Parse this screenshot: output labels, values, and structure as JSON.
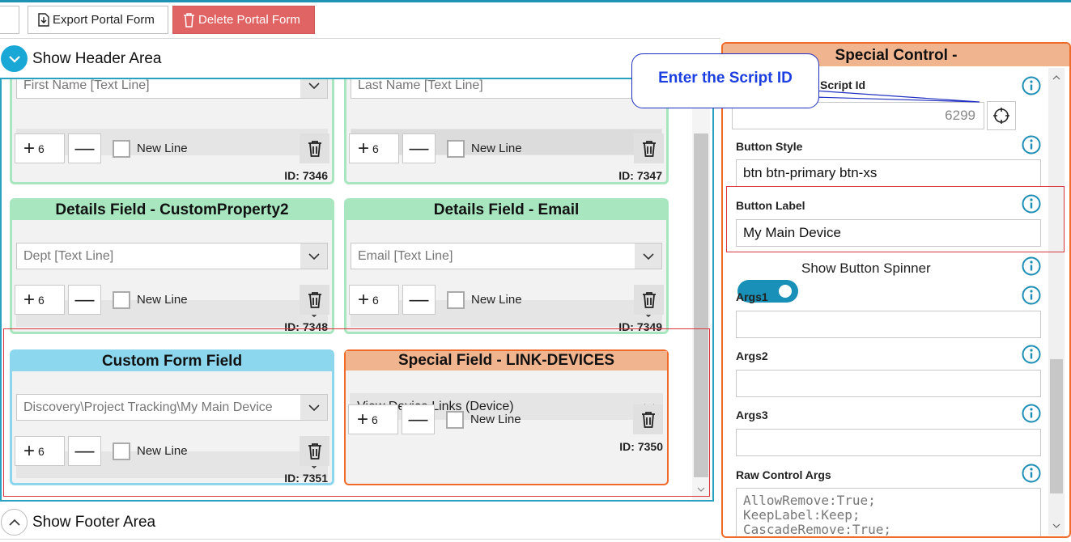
{
  "toolbar": {
    "export_label": "Export Portal Form",
    "delete_label": "Delete Portal Form"
  },
  "header_area": {
    "label": "Show Header Area"
  },
  "footer_area": {
    "label": "Show Footer Area"
  },
  "cards": [
    {
      "title": "",
      "select": "First Name [Text Line]",
      "count": "6",
      "newline": "New Line",
      "id": "ID: 7346"
    },
    {
      "title": "",
      "select": "Last Name [Text Line]",
      "count": "6",
      "newline": "New Line",
      "id": "ID: 7347"
    },
    {
      "title": "Details Field - CustomProperty2",
      "select": "Dept [Text Line]",
      "count": "6",
      "newline": "New Line",
      "id": "ID: 7348"
    },
    {
      "title": "Details Field - Email",
      "select": "Email [Text Line]",
      "count": "6",
      "newline": "New Line",
      "id": "ID: 7349"
    },
    {
      "title": "Custom Form Field",
      "select": "Discovery\\Project Tracking\\My Main Device",
      "count": "6",
      "newline": "New Line",
      "id": "ID: 7351"
    },
    {
      "title": "Special Field -  LINK-DEVICES",
      "select": "View Device Links (Device)",
      "count": "6",
      "newline": "New Line",
      "id": "ID: 7350"
    }
  ],
  "panel": {
    "title": "Special Control -",
    "script_id_label": "Script Id",
    "script_id_value": "6299",
    "button_style_label": "Button Style",
    "button_style_value": "btn btn-primary btn-xs",
    "button_label_label": "Button Label",
    "button_label_value": "My  Main Device",
    "spinner_label": "Show Button Spinner",
    "args1_label": "Args1",
    "args2_label": "Args2",
    "args3_label": "Args3",
    "raw_label": "Raw Control Args",
    "raw_lines": [
      "AllowRemove:True;",
      "KeepLabel:Keep;",
      "CascadeRemove:True;"
    ]
  },
  "callout": {
    "text": "Enter the Script ID"
  },
  "colors": {
    "accent": "#1e93b4",
    "delete": "#e06464",
    "green_card": "#a8e6bf",
    "blue_card": "#8dd7ee",
    "orange": "#f06a2a",
    "highlight": "#d9363e"
  }
}
